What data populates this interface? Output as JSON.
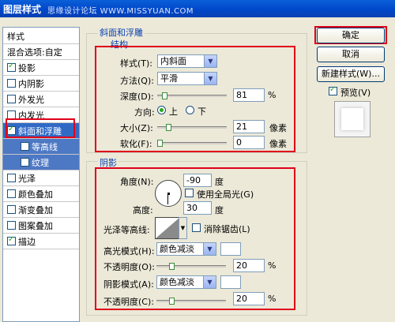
{
  "window": {
    "title": "图层样式",
    "watermark": "思缘设计论坛 WWW.MISSYUAN.COM"
  },
  "sidebar": {
    "items": [
      {
        "label": "样式",
        "checkbox": false,
        "checked": false
      },
      {
        "label": "混合选项:自定",
        "checkbox": false,
        "checked": false
      },
      {
        "label": "投影",
        "checkbox": true,
        "checked": true
      },
      {
        "label": "内阴影",
        "checkbox": true,
        "checked": false
      },
      {
        "label": "外发光",
        "checkbox": true,
        "checked": false
      },
      {
        "label": "内发光",
        "checkbox": true,
        "checked": false
      },
      {
        "label": "斜面和浮雕",
        "checkbox": true,
        "checked": true,
        "selected": true
      },
      {
        "label": "等高线",
        "checkbox": true,
        "checked": false,
        "sub": true
      },
      {
        "label": "纹理",
        "checkbox": true,
        "checked": false,
        "sub": true
      },
      {
        "label": "光泽",
        "checkbox": true,
        "checked": false
      },
      {
        "label": "颜色叠加",
        "checkbox": true,
        "checked": false
      },
      {
        "label": "渐变叠加",
        "checkbox": true,
        "checked": false
      },
      {
        "label": "图案叠加",
        "checkbox": true,
        "checked": false
      },
      {
        "label": "描边",
        "checkbox": true,
        "checked": true
      }
    ]
  },
  "bevel": {
    "section_title": "斜面和浮雕",
    "structure_title": "结构",
    "style_label": "样式(T):",
    "style_value": "内斜面",
    "technique_label": "方法(Q):",
    "technique_value": "平滑",
    "depth_label": "深度(D):",
    "depth_value": "81",
    "depth_unit": "%",
    "depth_level": 0.08,
    "direction_label": "方向:",
    "direction_up": "上",
    "direction_down": "下",
    "direction_selected": "up",
    "size_label": "大小(Z):",
    "size_value": "21",
    "size_unit": "像素",
    "size_level": 0.14,
    "soften_label": "软化(F):",
    "soften_value": "0",
    "soften_unit": "像素",
    "soften_level": 0.0
  },
  "shading": {
    "title": "阴影",
    "angle_label": "角度(N):",
    "angle_value": "-90",
    "angle_unit": "度",
    "global_light_label": "使用全局光(G)",
    "altitude_label": "高度:",
    "altitude_value": "30",
    "altitude_unit": "度",
    "gloss_label": "光泽等高线:",
    "antialias_label": "消除锯齿(L)",
    "highlight_mode_label": "高光模式(H):",
    "highlight_mode_value": "颜色减淡",
    "highlight_opacity_label": "不透明度(O):",
    "highlight_opacity_value": "20",
    "highlight_opacity_unit": "%",
    "highlight_opacity_level": 0.2,
    "shadow_mode_label": "阴影模式(A):",
    "shadow_mode_value": "颜色减淡",
    "shadow_opacity_label": "不透明度(C):",
    "shadow_opacity_value": "20",
    "shadow_opacity_unit": "%",
    "shadow_opacity_level": 0.2
  },
  "buttons": {
    "ok": "确定",
    "cancel": "取消",
    "new_style": "新建样式(W)...",
    "preview": "预览(V)"
  },
  "colors": {
    "accent_red": "#e0001a",
    "selection_blue": "#316ac5",
    "titlebar_blue": "#0a5fd8"
  }
}
